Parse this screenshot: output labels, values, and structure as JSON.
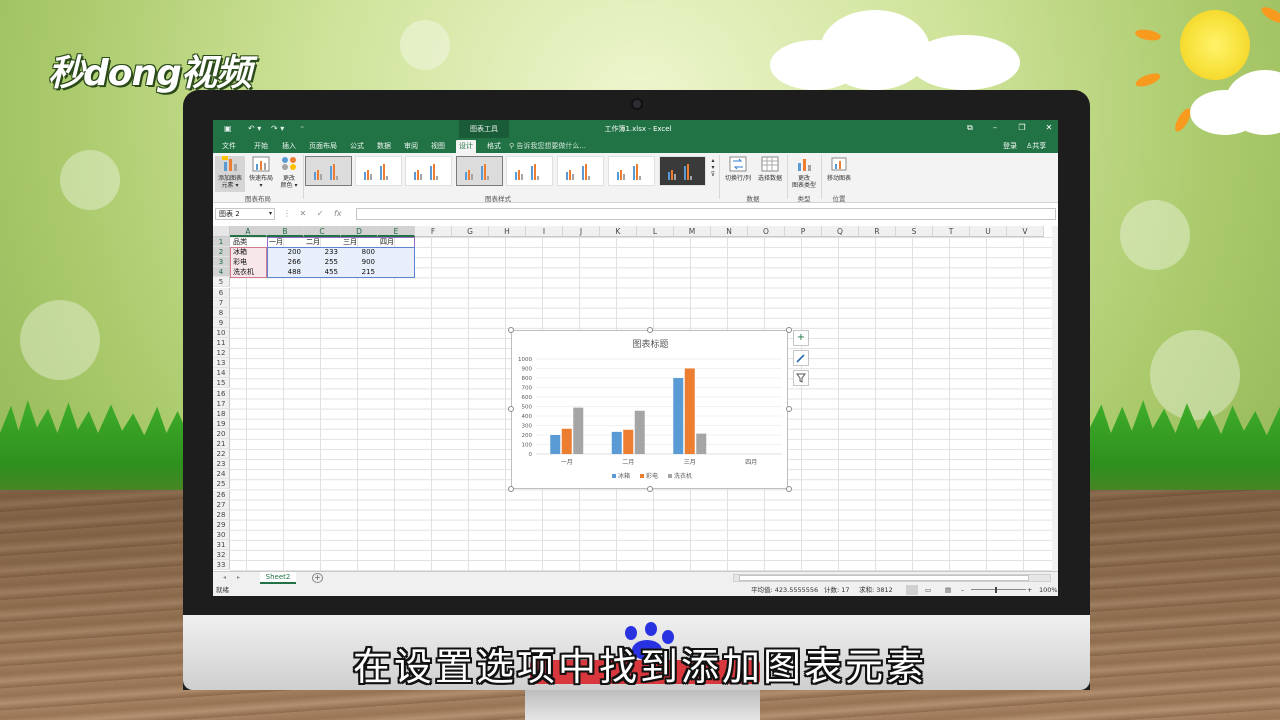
{
  "overlay": {
    "logo_text": "秒dong视频",
    "subtitle": "在设置选项中找到添加图表元素"
  },
  "excel": {
    "title": "工作簿1.xlsx - Excel",
    "contextual_tab_group": "图表工具",
    "tabs": [
      "文件",
      "开始",
      "插入",
      "页面布局",
      "公式",
      "数据",
      "审阅",
      "视图",
      "设计",
      "格式"
    ],
    "active_tab": "设计",
    "tell_me": "告诉我您想要做什么...",
    "login": "登录",
    "share": "共享",
    "ribbon": {
      "add_element_l1": "添加图表",
      "add_element_l2": "元素 ▾",
      "quick_layout_l1": "快速布局",
      "quick_layout_l2": "▾",
      "change_colors_l1": "更改",
      "change_colors_l2": "颜色 ▾",
      "switch_row_col": "切换行/列",
      "select_data": "选择数据",
      "change_type_l1": "更改",
      "change_type_l2": "图表类型",
      "move_chart": "移动图表",
      "group_layouts": "图表布局",
      "group_styles": "图表样式",
      "group_data": "数据",
      "group_type": "类型",
      "group_location": "位置"
    },
    "name_box": "图表 2",
    "formula_icons": {
      "cancel": "✕",
      "enter": "✓",
      "fx": "fx"
    },
    "columns": [
      "A",
      "B",
      "C",
      "D",
      "E",
      "F",
      "G",
      "H",
      "I",
      "J",
      "K",
      "L",
      "M",
      "N",
      "O",
      "P",
      "Q",
      "R",
      "S",
      "T",
      "U",
      "V"
    ],
    "rows": [
      "1",
      "2",
      "3",
      "4",
      "5",
      "6",
      "7",
      "8",
      "9",
      "10",
      "11",
      "12",
      "13",
      "14",
      "15",
      "16",
      "17",
      "18",
      "19",
      "20",
      "21",
      "22",
      "23",
      "24",
      "25",
      "26",
      "27",
      "28",
      "29",
      "30",
      "31",
      "32",
      "33"
    ],
    "table": {
      "header": [
        "品类",
        "一月",
        "二月",
        "三月",
        "四月"
      ],
      "rows": [
        [
          "冰箱",
          "200",
          "233",
          "800"
        ],
        [
          "彩电",
          "266",
          "255",
          "900"
        ],
        [
          "洗衣机",
          "488",
          "455",
          "215"
        ]
      ]
    },
    "sheet_tab": "Sheet2",
    "status": {
      "ready": "就绪",
      "average": "平均值: 423.5555556",
      "count": "计数: 17",
      "sum": "求和: 3812",
      "zoom": "100%"
    }
  },
  "chart_data": {
    "type": "bar",
    "title": "图表标题",
    "categories": [
      "一月",
      "二月",
      "三月",
      "四月"
    ],
    "series": [
      {
        "name": "冰箱",
        "values": [
          200,
          233,
          800,
          null
        ],
        "color": "#5b9bd5"
      },
      {
        "name": "彩电",
        "values": [
          266,
          255,
          900,
          null
        ],
        "color": "#ed7d31"
      },
      {
        "name": "洗衣机",
        "values": [
          488,
          455,
          215,
          null
        ],
        "color": "#a5a5a5"
      }
    ],
    "ylim": [
      0,
      1000
    ],
    "yticks": [
      0,
      100,
      200,
      300,
      400,
      500,
      600,
      700,
      800,
      900,
      1000
    ],
    "grid": true,
    "legend": "bottom"
  },
  "colors": {
    "excel_green": "#217346"
  },
  "icons": [
    "excel-save-icon",
    "undo-icon",
    "redo-icon",
    "plus-icon",
    "brush-icon",
    "filter-icon",
    "user-icon"
  ]
}
